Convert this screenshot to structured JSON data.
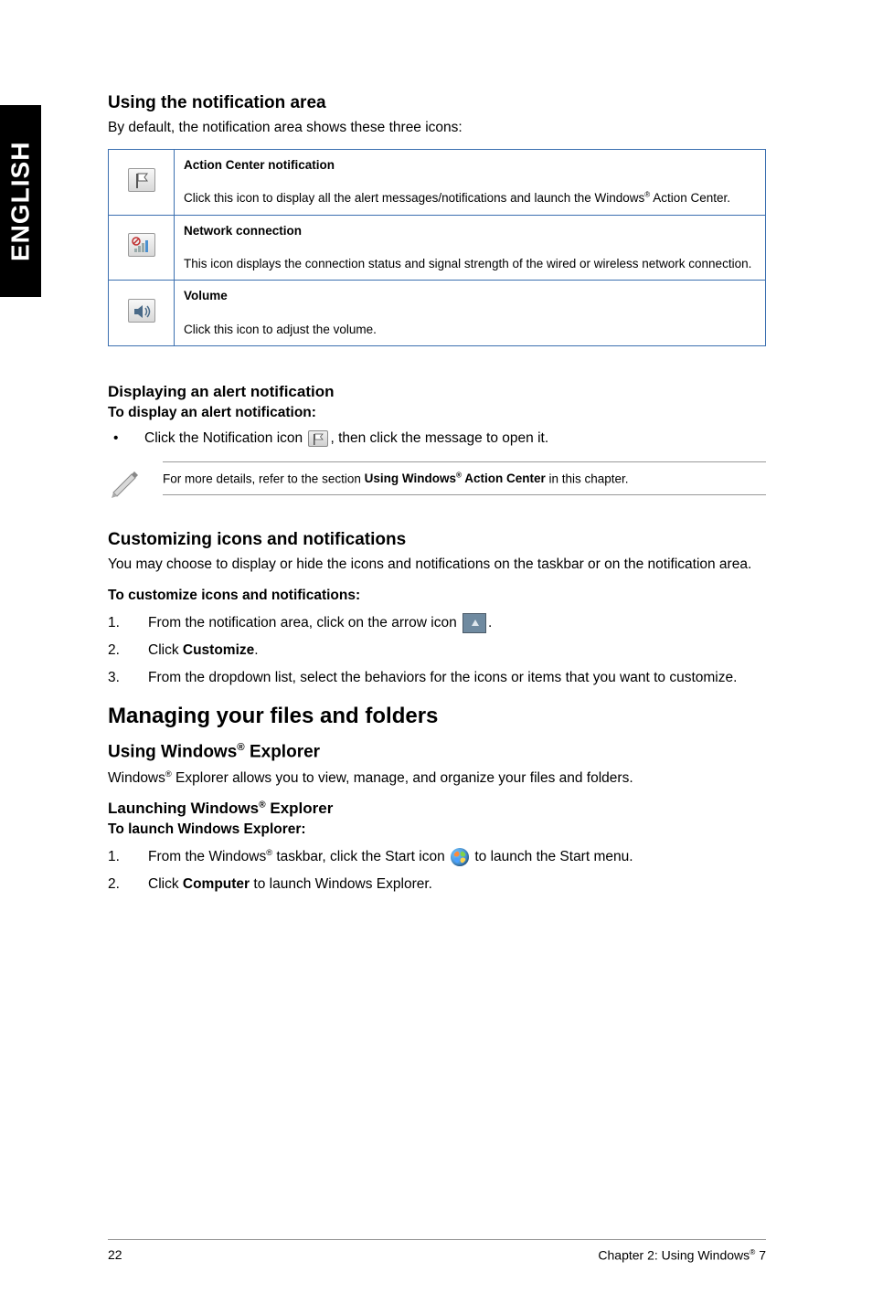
{
  "sideTab": "ENGLISH",
  "sec1": {
    "heading": "Using the notification area",
    "intro": "By default, the notification area shows these three icons:",
    "rows": [
      {
        "title": "Action Center notification",
        "desc_pre": "Click this icon to display all the alert messages/notifications and launch the Windows",
        "desc_post": " Action Center."
      },
      {
        "title": "Network connection",
        "desc": "This icon displays the connection status and signal strength of the wired or wireless network connection."
      },
      {
        "title": "Volume",
        "desc": "Click this icon to adjust the volume."
      }
    ]
  },
  "sec2": {
    "heading": "Displaying an alert notification",
    "subBold": "To display an alert notification:",
    "bullet_pre": "Click the Notification icon ",
    "bullet_post": ", then click the message to open it.",
    "note_pre": "For more details, refer to the section ",
    "note_bold_pre": "Using Windows",
    "note_bold_post": " Action Center",
    "note_post": " in this chapter."
  },
  "sec3": {
    "heading": "Customizing icons and notifications",
    "intro": "You may choose to display or hide the icons and notifications on the taskbar or on the notification area.",
    "subBold": "To customize icons and notifications:",
    "step1_pre": "From the notification area, click on the arrow icon ",
    "step1_post": ".",
    "step2_pre": "Click ",
    "step2_bold": "Customize",
    "step2_post": ".",
    "step3": "From the dropdown list, select the behaviors for the icons or items that you want to customize."
  },
  "sec4": {
    "heading": "Managing your files and folders",
    "sub1_pre": "Using Windows",
    "sub1_post": " Explorer",
    "intro_pre": "Windows",
    "intro_post": " Explorer allows you to view, manage, and organize your files and folders.",
    "sub2_pre": "Launching Windows",
    "sub2_post": " Explorer",
    "subBold": "To launch Windows Explorer:",
    "step1_pre": "From the Windows",
    "step1_mid": " taskbar, click the Start icon ",
    "step1_post": " to launch the Start menu.",
    "step2_pre": "Click ",
    "step2_bold": "Computer",
    "step2_post": " to launch Windows Explorer."
  },
  "footer": {
    "page": "22",
    "chapter_pre": "Chapter 2: Using Windows",
    "chapter_post": " 7"
  }
}
